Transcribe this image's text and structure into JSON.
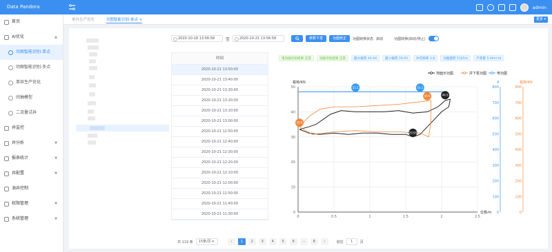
{
  "app": {
    "title": "Data Pandora",
    "user": "admin"
  },
  "sidebar": {
    "items": [
      {
        "label": "首页"
      },
      {
        "label": "AI优化"
      },
      {
        "label": "功图智能识别-单点"
      },
      {
        "label": "功图智能识别-多点"
      },
      {
        "label": "单井生产优化"
      },
      {
        "label": "间抽模型"
      },
      {
        "label": "二流量试井"
      },
      {
        "label": "井监控"
      },
      {
        "label": "井分析"
      },
      {
        "label": "报表统计"
      },
      {
        "label": "井配置"
      },
      {
        "label": "油井控制"
      },
      {
        "label": "权限管理"
      },
      {
        "label": "系统管理"
      }
    ]
  },
  "tabs": [
    {
      "label": "单井生产优化"
    },
    {
      "label": "功图智能识别-单点"
    }
  ],
  "more_label": "更多",
  "filter": {
    "start": "2020-10-18 13:56:58",
    "to": "至",
    "end": "2020-10-21 13:56:58",
    "params_btn": "参数下发",
    "recalc_btn": "功图修正",
    "state_label": "功图转换状态",
    "state_value": "启动",
    "switch_label": "功图转换(启动/停止)"
  },
  "table": {
    "header": "时间",
    "rows": [
      "2020-10-21 13:50:00",
      "2020-10-21 13:40:00",
      "2020-10-21 13:30:00",
      "2020-10-21 13:20:00",
      "2020-10-21 13:10:00",
      "2020-10-21 13:00:00",
      "2020-10-21 12:50:00",
      "2020-10-21 12:40:00",
      "2020-10-21 12:30:00",
      "2020-10-21 12:20:00",
      "2020-10-21 12:10:00",
      "2020-10-21 12:00:00",
      "2020-10-21 11:50:00",
      "2020-10-21 11:40:00",
      "2020-10-21 11:30:00"
    ]
  },
  "stats": [
    "电功图识别结果 正常",
    "功图识别结果 正常",
    "最大载荷 44.94",
    "最小载荷 29.95",
    "冲次频率 3.8",
    "功图面积 1545m",
    "产液量 5.94m³/d"
  ],
  "pager": {
    "total": "共 119 条",
    "size": "15条/页",
    "pages": [
      "1",
      "2",
      "3",
      "4",
      "5",
      "6",
      "···",
      "8"
    ],
    "goto_prefix": "前往",
    "goto_value": "1",
    "goto_suffix": "页"
  },
  "chart_data": {
    "type": "line",
    "ylabel": "载荷/KN",
    "xlabel": "位移/m",
    "y2label": "A",
    "y3label": "载荷/KN",
    "legend": [
      "地面示功图",
      "井下泵功图",
      "电功图"
    ],
    "xlim": [
      0,
      2.5
    ],
    "ylim": [
      0,
      50
    ],
    "y2lim": [
      0,
      800
    ],
    "y3lim": [
      0,
      800
    ],
    "x_ticks": [
      "0",
      "0.5",
      "1",
      "1.5",
      "2",
      "2.5"
    ],
    "y_ticks": [
      "0",
      "10",
      "20",
      "30",
      "40",
      "50"
    ],
    "y2_ticks": [
      "0",
      "100",
      "200",
      "300",
      "400",
      "500",
      "600",
      "700",
      "800"
    ],
    "y3_ticks": [
      "0",
      "100",
      "200",
      "300",
      "400",
      "500",
      "600",
      "700",
      "800"
    ],
    "markers": [
      {
        "label": "53.1",
        "x": 0.8,
        "y": 48
      },
      {
        "label": "53.1",
        "x": 1.7,
        "y": 48
      },
      {
        "label": "44.9",
        "x": 2.05,
        "y": 45
      },
      {
        "label": "29.95",
        "x": 1.6,
        "y": 30
      },
      {
        "label": "44.6",
        "x": 1.8,
        "y": 44.6
      },
      {
        "label": "29.8",
        "x": 0.02,
        "y": 34
      }
    ],
    "colors": {
      "surface": "#222222",
      "pump": "#f0883a",
      "electric": "#3b9bf0"
    }
  }
}
